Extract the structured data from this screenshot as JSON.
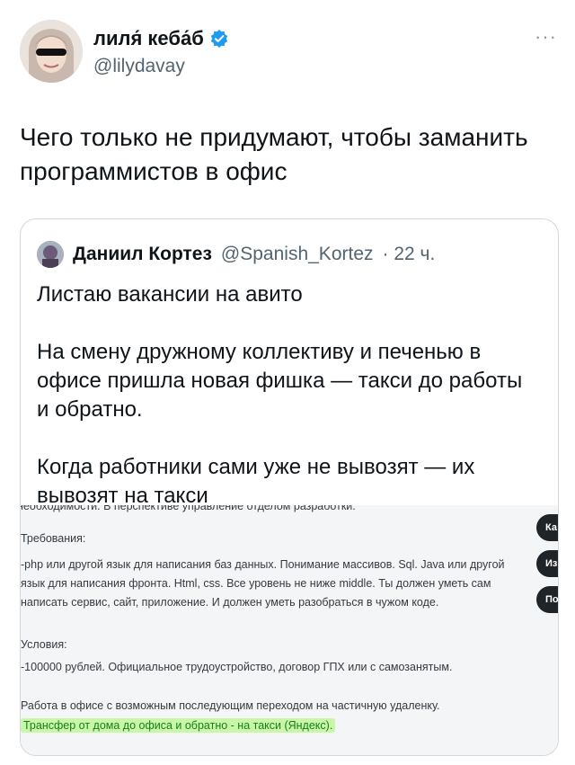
{
  "author": {
    "name": "лиля́ кеба́б",
    "handle": "@lilydavay"
  },
  "more_label": "···",
  "tweet": {
    "text": "Чего только не придумают, чтобы заманить программистов в офис"
  },
  "quote": {
    "name": "Даниил Кортез",
    "handle": "@Spanish_Kortez",
    "time": "· 22 ч.",
    "paragraphs": [
      "Листаю вакансии на авито",
      "На смену дружному коллективу и печенью в офисе пришла новая фишка — такси до работы и обратно.",
      "Когда работники сами уже не вывозят — их вывозят на такси"
    ]
  },
  "screenshot": {
    "cut_line": "необходимости. В перспективе управление отделом разработки.",
    "requirements_title": "Требования:",
    "requirements_text": "-php или другой язык для написания баз данных. Понимание массивов. Sql. Java или другой язык для написания фронта. Html, css. Все уровень не ниже middle. Ты должен уметь сам написать сервис, сайт, приложение. И должен уметь разобраться в чужом коде.",
    "conditions_title": "Условия:",
    "conditions_text": "-100000 рублей. Официальное трудоустройство, договор ГПХ или с самозанятым.",
    "office_text": "Работа в офисе с возможным последующим переходом на частичную удаленку.",
    "highlight_text": "Трансфер от дома до офиса и обратно - на такси (Яндекс).",
    "side_buttons": [
      "Ка",
      "Из",
      "По"
    ]
  },
  "colors": {
    "verified": "#1d9bf0",
    "highlight_bg": "#c9f7a8",
    "highlight_text": "#1a7d1a"
  }
}
